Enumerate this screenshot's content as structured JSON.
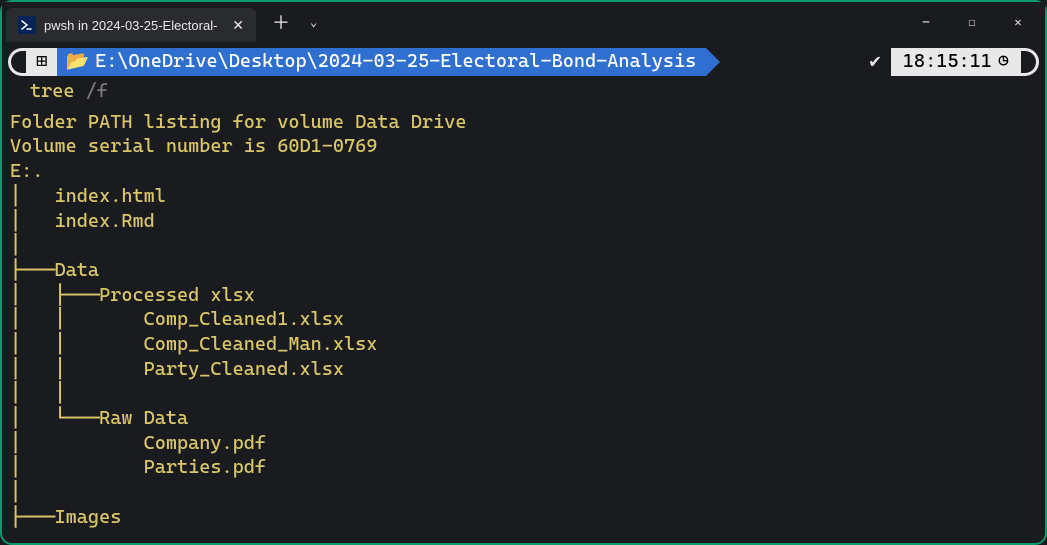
{
  "titlebar": {
    "tab_title": "pwsh in 2024-03-25-Electoral-",
    "close_glyph": "✕",
    "newtab_glyph": "＋",
    "dropdown_glyph": "⌄"
  },
  "window_controls": {
    "minimize": "—",
    "maximize": "☐",
    "close": "✕"
  },
  "prompt": {
    "os_glyph": "⊞",
    "folder_glyph": "📂",
    "path": "E:\\OneDrive\\Desktop\\2024-03-25-Electoral-Bond-Analysis",
    "check_glyph": "✔",
    "time": "18:15:11",
    "clock_glyph": "◷"
  },
  "command": {
    "cmd": "tree",
    "arg": "/f"
  },
  "output": "Folder PATH listing for volume Data Drive\nVolume serial number is 60D1-0769\nE:.\n│   index.html\n│   index.Rmd\n│\n├───Data\n│   ├───Processed xlsx\n│   │       Comp_Cleaned1.xlsx\n│   │       Comp_Cleaned_Man.xlsx\n│   │       Party_Cleaned.xlsx\n│   │\n│   └───Raw Data\n│           Company.pdf\n│           Parties.pdf\n│\n├───Images"
}
